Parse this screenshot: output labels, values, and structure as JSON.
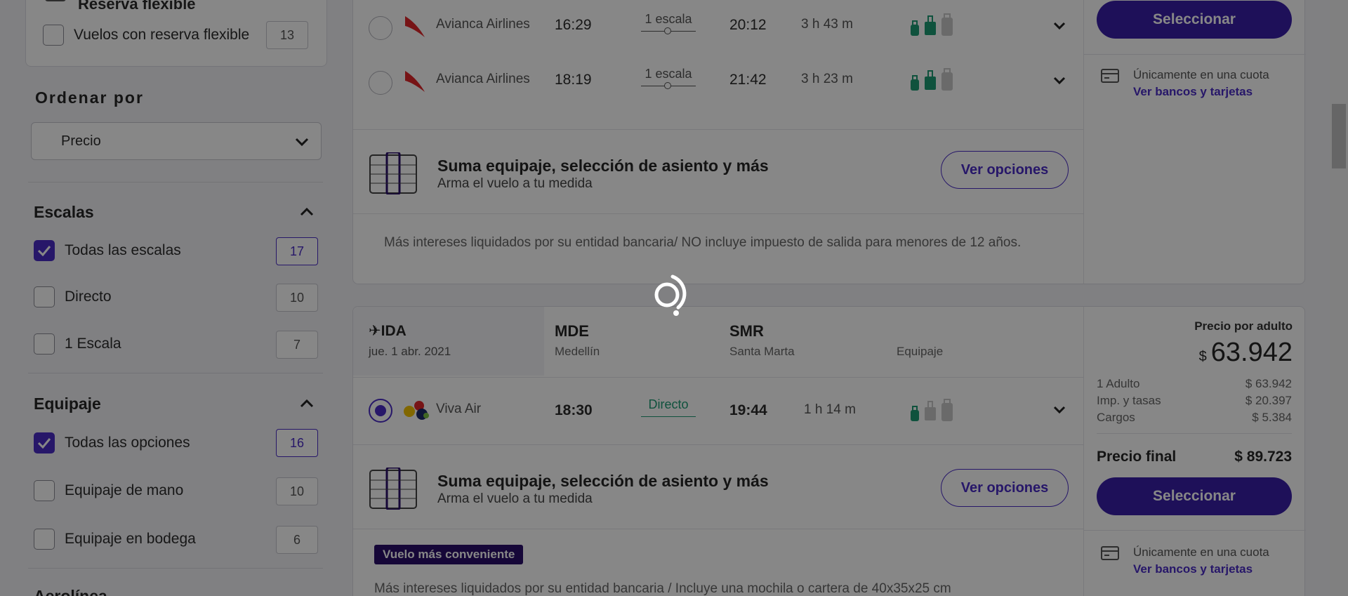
{
  "sidebar": {
    "flexible": {
      "title": "Reserva flexible",
      "option_label": "Vuelos con reserva flexible",
      "option_count": "13"
    },
    "sort": {
      "title": "Ordenar por",
      "selected": "Precio"
    },
    "stops": {
      "title": "Escalas",
      "options": [
        {
          "label": "Todas las escalas",
          "count": "17",
          "checked": true
        },
        {
          "label": "Directo",
          "count": "10",
          "checked": false
        },
        {
          "label": "1 Escala",
          "count": "7",
          "checked": false
        }
      ]
    },
    "baggage": {
      "title": "Equipaje",
      "options": [
        {
          "label": "Todas las opciones",
          "count": "16",
          "checked": true
        },
        {
          "label": "Equipaje de mano",
          "count": "10",
          "checked": false
        },
        {
          "label": "Equipaje en bodega",
          "count": "6",
          "checked": false
        }
      ]
    },
    "next_section_partial": "Aerolínea"
  },
  "card1": {
    "flights": [
      {
        "airline": "Avianca Airlines",
        "depart": "16:29",
        "stops": "1 escala",
        "arrive": "20:12",
        "duration": "3 h 43 m"
      },
      {
        "airline": "Avianca Airlines",
        "depart": "18:19",
        "stops": "1 escala",
        "arrive": "21:42",
        "duration": "3 h 23 m"
      }
    ],
    "addon": {
      "title": "Suma equipaje, selección de asiento y más",
      "subtitle": "Arma el vuelo a tu medida",
      "button": "Ver opciones"
    },
    "note": "Más intereses liquidados por su entidad bancaria/ NO incluye impuesto de salida para menores de 12 años.",
    "select_button": "Seleccionar",
    "cuota": {
      "text": "Únicamente en una cuota",
      "link": "Ver bancos y tarjetas"
    }
  },
  "card2": {
    "direction": "IDA",
    "date": "jue. 1 abr. 2021",
    "origin": {
      "code": "MDE",
      "city": "Medellín"
    },
    "destination": {
      "code": "SMR",
      "city": "Santa Marta"
    },
    "baggage_label": "Equipaje",
    "flight": {
      "airline": "Viva Air",
      "depart": "18:30",
      "stops": "Directo",
      "arrive": "19:44",
      "duration": "1 h 14 m"
    },
    "addon": {
      "title": "Suma equipaje, selección de asiento y más",
      "subtitle": "Arma el vuelo a tu medida",
      "button": "Ver opciones"
    },
    "badge": "Vuelo más conveniente",
    "note": "Más intereses liquidados por su entidad bancaria / Incluye una mochila o cartera de 40x35x25 cm",
    "price": {
      "header": "Precio por adulto",
      "currency": "$",
      "amount": "63.942",
      "lines": [
        {
          "label": "1 Adulto",
          "value": "$ 63.942"
        },
        {
          "label": "Imp. y tasas",
          "value": "$ 20.397"
        },
        {
          "label": "Cargos",
          "value": "$ 5.384"
        }
      ],
      "final_label": "Precio final",
      "final_value": "$ 89.723"
    },
    "select_button": "Seleccionar",
    "cuota": {
      "text": "Únicamente en una cuota",
      "link": "Ver bancos y tarjetas"
    }
  },
  "colors": {
    "accent": "#4a2cc7",
    "button": "#3a1fa8",
    "direct": "#1d9b74",
    "badge": "#2a0f6b"
  }
}
